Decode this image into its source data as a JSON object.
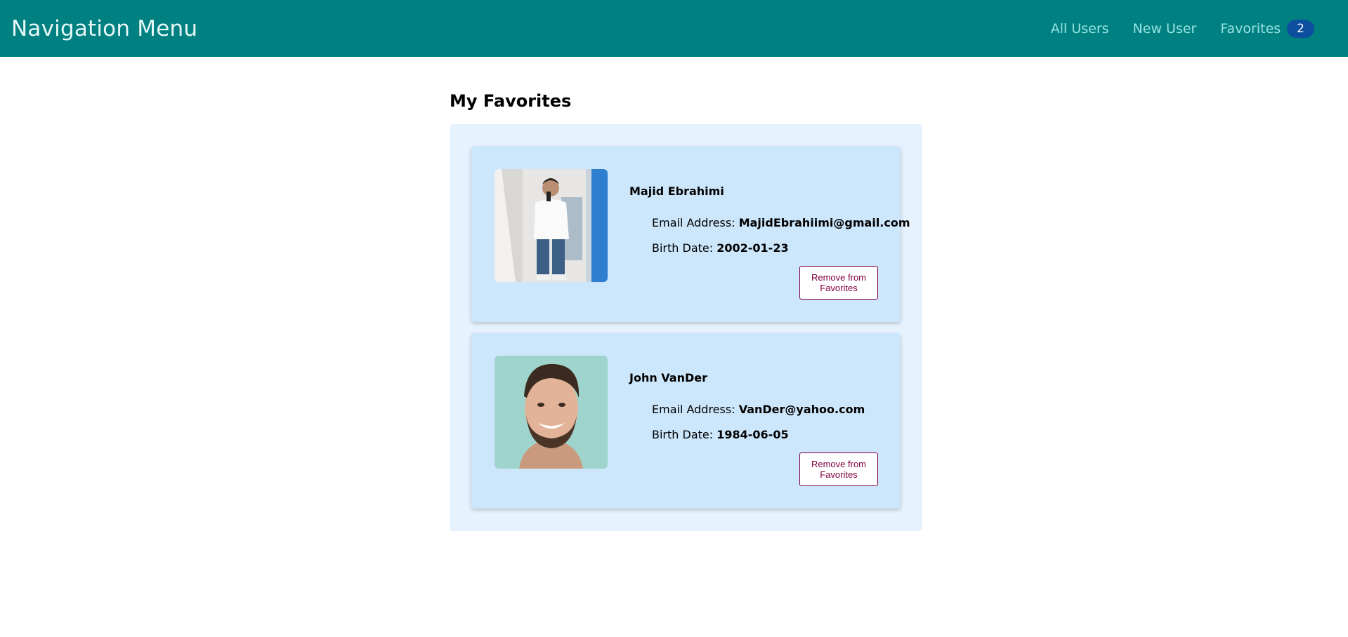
{
  "navbar": {
    "brand": "Navigation Menu",
    "links": [
      {
        "label": "All Users"
      },
      {
        "label": "New User"
      },
      {
        "label": "Favorites",
        "count": "2"
      }
    ]
  },
  "page": {
    "title": "My Favorites"
  },
  "favorites": [
    {
      "name": "Majid Ebrahimi",
      "email_label": "Email Address:",
      "email": "MajidEbrahiimi@gmail.com",
      "birth_label": "Birth Date:",
      "birth_date": "2002-01-23",
      "remove_label": "Remove from Favorites"
    },
    {
      "name": "John VanDer",
      "email_label": "Email Address:",
      "email": "VanDer@yahoo.com",
      "birth_label": "Birth Date:",
      "birth_date": "1984-06-05",
      "remove_label": "Remove from Favorites"
    }
  ],
  "colors": {
    "navbar": "#008080",
    "badge": "#0b4f9e",
    "panel": "#e6f3ff",
    "card": "#cce6fb",
    "button_border": "#800040"
  }
}
